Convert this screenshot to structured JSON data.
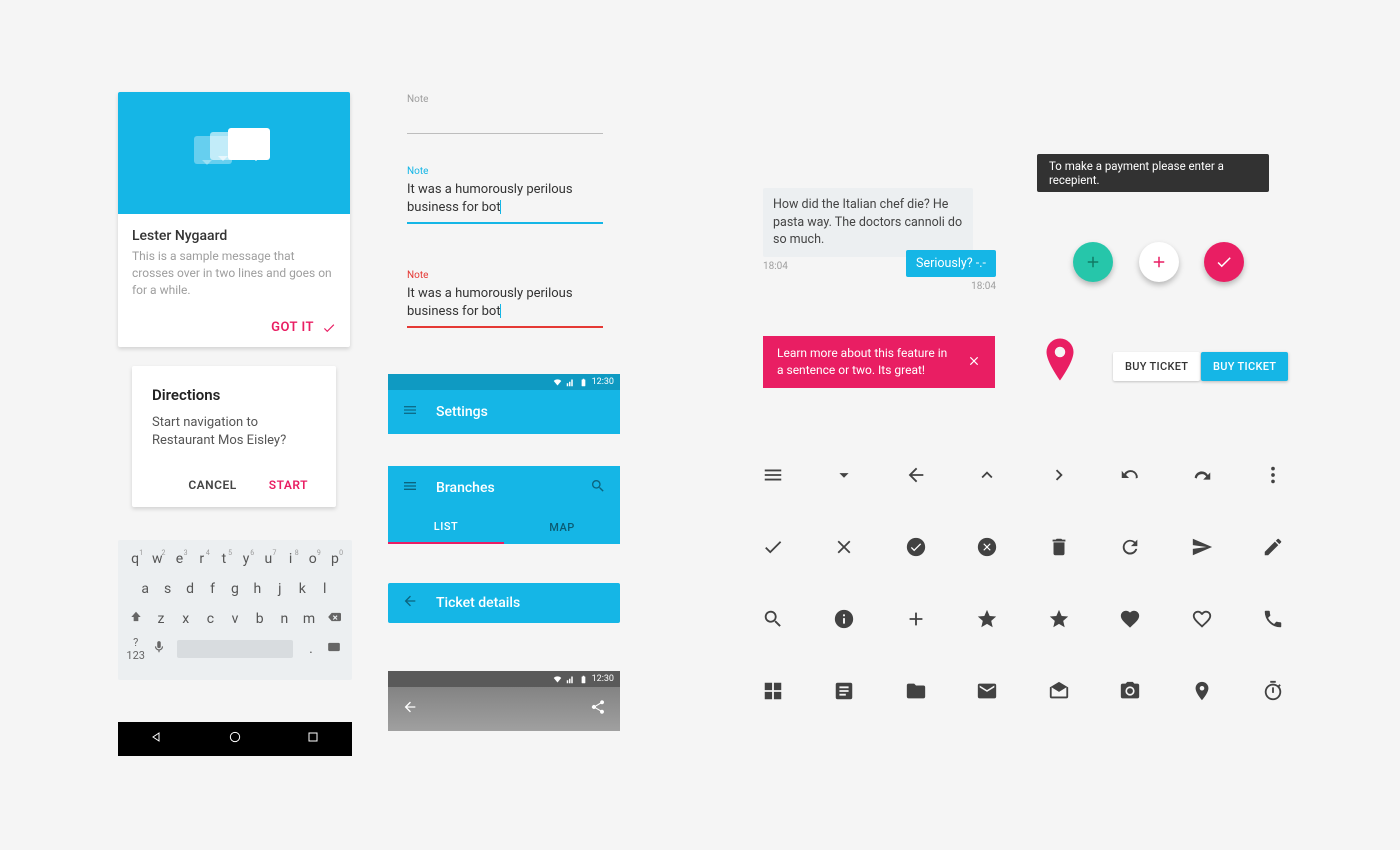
{
  "colors": {
    "accent": "#e91e63",
    "primary": "#15b6e6",
    "green": "#26c6aa",
    "error": "#e53935",
    "dark": "#323232"
  },
  "messageCard": {
    "name": "Lester Nygaard",
    "text": "This is a sample message that crosses over in two lines and goes on for a while.",
    "action": "GOT IT"
  },
  "dialog": {
    "title": "Directions",
    "body": "Start navigation to Restaurant Mos Eisley?",
    "cancel": "CANCEL",
    "confirm": "START"
  },
  "keyboard": {
    "row1": [
      "q",
      "w",
      "e",
      "r",
      "t",
      "y",
      "u",
      "i",
      "o",
      "p"
    ],
    "nums": [
      "1",
      "2",
      "3",
      "4",
      "5",
      "6",
      "7",
      "8",
      "9",
      "0"
    ],
    "row2": [
      "a",
      "s",
      "d",
      "f",
      "g",
      "h",
      "j",
      "k",
      "l"
    ],
    "row3": [
      "z",
      "x",
      "c",
      "v",
      "b",
      "n",
      "m"
    ],
    "symKey": "?123",
    "period": "."
  },
  "textFields": {
    "label": "Note",
    "value": "It was a humorously perilous business for bot"
  },
  "appbars": {
    "time": "12:30",
    "settings": "Settings",
    "branches": "Branches",
    "tabList": "LIST",
    "tabMap": "MAP",
    "ticket": "Ticket details"
  },
  "chat": {
    "incoming": "How did the Italian chef die? He pasta way. The doctors cannoli do so much.",
    "outgoing": "Seriously? -.-",
    "time": "18:04"
  },
  "snackbar": "Learn more about this feature in a sentence or two. Its great!",
  "toast": "To make a payment please enter a recepient.",
  "buttons": {
    "flat": "BUY TICKET",
    "raised": "BUY TICKET"
  },
  "iconGrid": [
    [
      "menu",
      "dropdown",
      "arrow-back",
      "chevron-up",
      "chevron-right",
      "redo",
      "undo",
      "more-vert"
    ],
    [
      "check",
      "close",
      "check-circle",
      "cancel-circle",
      "delete",
      "refresh",
      "send",
      "edit"
    ],
    [
      "search",
      "info",
      "plus",
      "star",
      "star",
      "heart",
      "heart-outline",
      "phone"
    ],
    [
      "apps",
      "note",
      "folder",
      "mail",
      "drafts",
      "camera",
      "place",
      "timer"
    ]
  ]
}
